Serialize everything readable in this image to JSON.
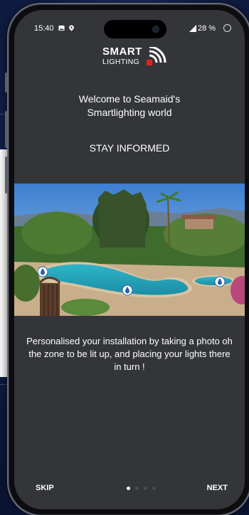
{
  "status_bar": {
    "time": "15:40",
    "battery": "28 %",
    "icons": [
      "gallery-icon",
      "location-icon",
      "signal-icon",
      "battery-ring-icon"
    ]
  },
  "logo": {
    "line1": "SMART",
    "line2": "LIGHTING"
  },
  "welcome": {
    "line1": "Welcome to Seamaid's",
    "line2": "Smartlighting world"
  },
  "section_title": "STAY INFORMED",
  "photo": {
    "pins": [
      "light-pin-icon",
      "light-pin-icon",
      "light-pin-icon"
    ]
  },
  "description": "Personalised your installation by taking a photo oh the zone to be lit up, and placing your lights there in turn !",
  "nav": {
    "skip_label": "SKIP",
    "next_label": "NEXT",
    "page_count": 4,
    "current_page": 1
  },
  "colors": {
    "screen_bg": "#333538",
    "text": "#ffffff",
    "logo_accent": "#e2231a",
    "dot_inactive": "#4a4c50",
    "dot_active": "#ffffff",
    "background": "#13224e"
  }
}
